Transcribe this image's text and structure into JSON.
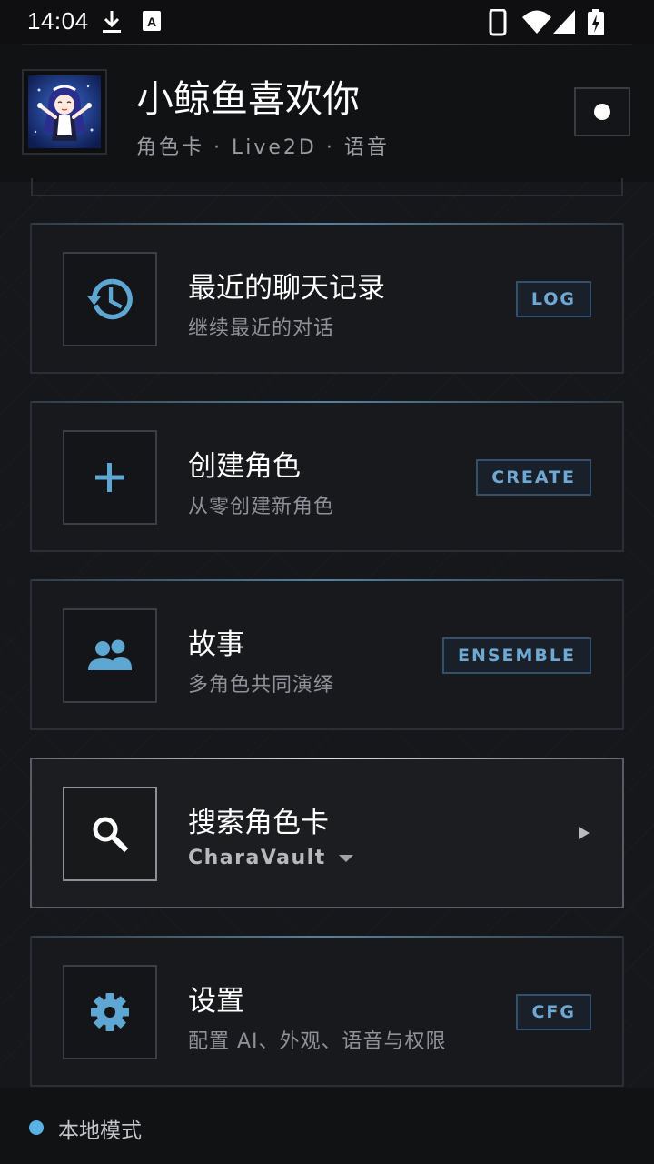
{
  "status_bar": {
    "time": "14:04",
    "icons": [
      "download-icon",
      "keyboard-a-icon",
      "phone-icon",
      "wifi-icon",
      "signal-icon",
      "battery-charging-icon"
    ]
  },
  "header": {
    "title": "小鲸鱼喜欢你",
    "subtitle": "角色卡 · Live2D · 语音",
    "record_button_icon": "record-dot-icon"
  },
  "menu": {
    "items": [
      {
        "title": "最近的聊天记录",
        "description": "继续最近的对话",
        "tag": "LOG",
        "icon": "history-icon"
      },
      {
        "title": "创建角色",
        "description": "从零创建新角色",
        "tag": "CREATE",
        "icon": "plus-icon"
      },
      {
        "title": "故事",
        "description": "多角色共同演绎",
        "tag": "ENSEMBLE",
        "icon": "group-icon"
      },
      {
        "title": "搜索角色卡",
        "source": "CharaVault",
        "icon": "search-icon",
        "action_icon": "play-arrow-icon"
      },
      {
        "title": "设置",
        "description": "配置 AI、外观、语音与权限",
        "tag": "CFG",
        "icon": "gear-icon"
      }
    ]
  },
  "footer": {
    "mode_label": "本地模式"
  },
  "colors": {
    "accent": "#6fa8d2",
    "icon_blue": "#5ea7d3",
    "status_dot": "#5ab1e6",
    "background": "#16171a"
  }
}
